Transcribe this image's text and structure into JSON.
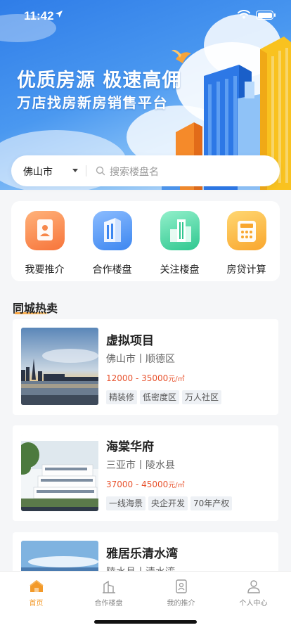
{
  "status_bar": {
    "time": "11:42"
  },
  "hero": {
    "title": "优质房源 极速高佣",
    "subtitle": "万店找房新房销售平台"
  },
  "search": {
    "city": "佛山市",
    "placeholder": "搜索楼盘名"
  },
  "quick_menu": [
    {
      "label": "我要推介",
      "icon": "contact-card-icon",
      "color": "#f7874a"
    },
    {
      "label": "合作楼盘",
      "icon": "building-icon",
      "color": "#3c86f0"
    },
    {
      "label": "关注楼盘",
      "icon": "city-buildings-icon",
      "color": "#2ec78f"
    },
    {
      "label": "房贷计算",
      "icon": "calculator-icon",
      "color": "#f9a62d"
    }
  ],
  "section": {
    "title": "同城热卖"
  },
  "listings": [
    {
      "name": "虚拟项目",
      "location": "佛山市丨顺德区",
      "price": "12000 - 35000",
      "unit": "元/㎡",
      "tags": [
        "精装修",
        "低密度区",
        "万人社区"
      ]
    },
    {
      "name": "海棠华府",
      "location": "三亚市丨陵水县",
      "price": "37000 - 45000",
      "unit": "元/㎡",
      "tags": [
        "一线海景",
        "央企开发",
        "70年产权"
      ]
    },
    {
      "name": "雅居乐清水湾",
      "location": "陵水县丨清水湾",
      "price": "",
      "unit": "",
      "tags": []
    }
  ],
  "tab_bar": {
    "items": [
      {
        "label": "首页",
        "icon": "home-icon",
        "active": true
      },
      {
        "label": "合作楼盘",
        "icon": "building-outline-icon",
        "active": false
      },
      {
        "label": "我的推介",
        "icon": "id-card-icon",
        "active": false
      },
      {
        "label": "个人中心",
        "icon": "user-icon",
        "active": false
      }
    ]
  },
  "colors": {
    "accent": "#f39a2a",
    "price": "#e8532e",
    "hero_blue": "#2f7de8"
  }
}
